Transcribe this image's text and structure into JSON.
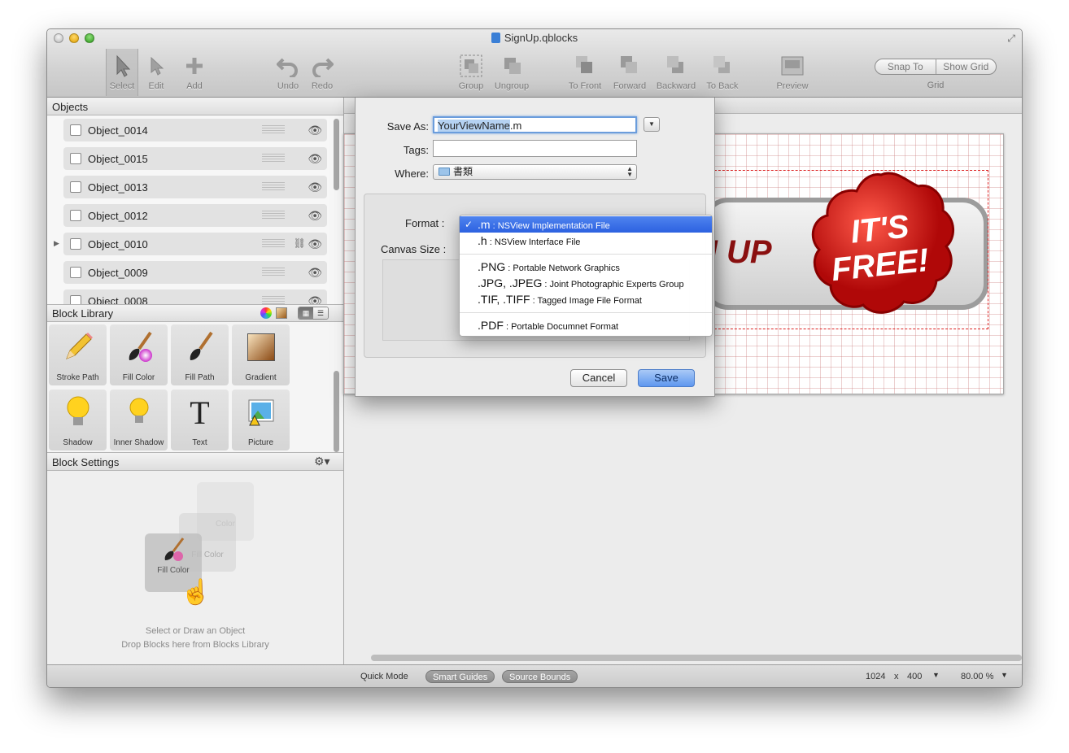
{
  "window": {
    "title": "SignUp.qblocks"
  },
  "toolbar": {
    "items": [
      {
        "label": "Select",
        "icon": "select-arrow-icon"
      },
      {
        "label": "Edit",
        "icon": "edit-arrow-icon"
      },
      {
        "label": "Add",
        "icon": "plus-icon"
      },
      {
        "label": "Undo",
        "icon": "undo-icon"
      },
      {
        "label": "Redo",
        "icon": "redo-icon"
      },
      {
        "label": "Group",
        "icon": "group-icon"
      },
      {
        "label": "Ungroup",
        "icon": "ungroup-icon"
      },
      {
        "label": "To Front",
        "icon": "to-front-icon"
      },
      {
        "label": "Forward",
        "icon": "forward-icon"
      },
      {
        "label": "Backward",
        "icon": "backward-icon"
      },
      {
        "label": "To Back",
        "icon": "to-back-icon"
      },
      {
        "label": "Preview",
        "icon": "preview-icon"
      }
    ],
    "grid": {
      "snap_to": "Snap To",
      "show_grid": "Show Grid",
      "label": "Grid"
    }
  },
  "objects": {
    "header": "Objects",
    "items": [
      "Object_0014",
      "Object_0015",
      "Object_0013",
      "Object_0012",
      "Object_0010",
      "Object_0009",
      "Object_0008"
    ]
  },
  "block_library": {
    "header": "Block Library",
    "items": [
      {
        "label": "Stroke Path",
        "icon": "pencil-icon"
      },
      {
        "label": "Fill Color",
        "icon": "paintbrush-color-icon"
      },
      {
        "label": "Fill Path",
        "icon": "paintbrush-icon"
      },
      {
        "label": "Gradient",
        "icon": "gradient-icon"
      },
      {
        "label": "Shadow",
        "icon": "lightbulb-icon"
      },
      {
        "label": "Inner Shadow",
        "icon": "lightbulb-small-icon"
      },
      {
        "label": "Text",
        "icon": "text-t-icon"
      },
      {
        "label": "Picture",
        "icon": "picture-icon"
      }
    ]
  },
  "block_settings": {
    "header": "Block Settings",
    "ghost_labels": [
      "Color",
      "Fill Color",
      "Fill Color"
    ],
    "hint_line1": "Select or Draw an Object",
    "hint_line2": "Drop Blocks here from Blocks Library"
  },
  "canvas": {
    "button_text": "N UP",
    "badge_line1": "IT'S",
    "badge_line2": "FREE!"
  },
  "save_sheet": {
    "save_as_label": "Save As:",
    "save_as_selected": "YourViewName",
    "save_as_ext": ".m",
    "tags_label": "Tags:",
    "tags_value": "",
    "where_label": "Where:",
    "where_value": "書類",
    "format_label": "Format :",
    "canvas_size_label": "Canvas Size :",
    "cancel_label": "Cancel",
    "save_label": "Save"
  },
  "format_menu": {
    "items": [
      {
        "ext": ".m",
        "desc": "NSView Implementation File",
        "checked": true
      },
      {
        "ext": ".h",
        "desc": "NSView Interface File"
      },
      {
        "ext": ".PNG",
        "desc": "Portable Network Graphics"
      },
      {
        "ext": ".JPG, .JPEG",
        "desc": "Joint Photographic Experts Group"
      },
      {
        "ext": ".TIF, .TIFF",
        "desc": "Tagged Image File Format"
      },
      {
        "ext": ".PDF",
        "desc": "Portable Documnet Format"
      }
    ],
    "separator": " : ",
    "check_mark": "✓"
  },
  "statusbar": {
    "quick_mode": "Quick Mode",
    "smart_guides": "Smart Guides",
    "source_bounds": "Source Bounds",
    "width": "1024",
    "times": "x",
    "height": "400",
    "zoom": "80.00 %"
  },
  "colors": {
    "accent": "#2c61e0",
    "badge_red": "#d41818",
    "grid_line": "#d9a8a8"
  }
}
